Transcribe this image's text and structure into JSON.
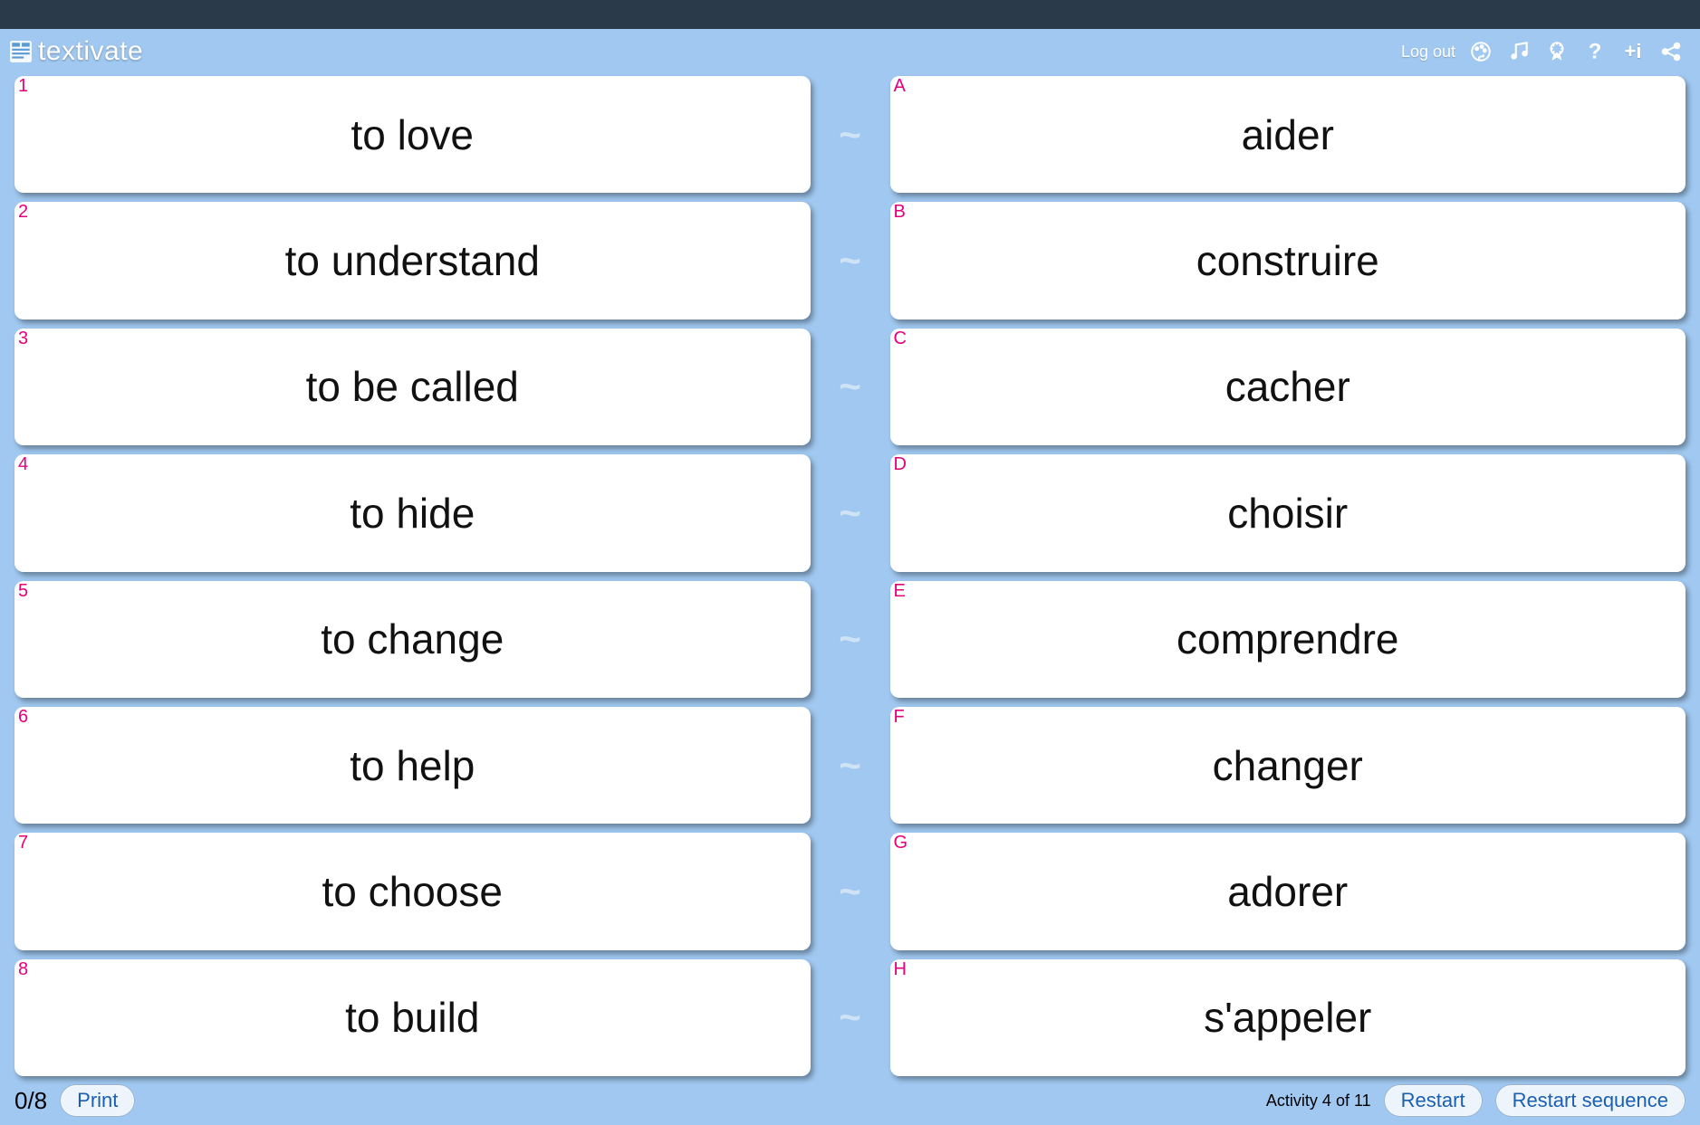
{
  "header": {
    "brand": "textivate",
    "logout": "Log out"
  },
  "left": [
    {
      "tag": "1",
      "text": "to love"
    },
    {
      "tag": "2",
      "text": "to understand"
    },
    {
      "tag": "3",
      "text": "to be called"
    },
    {
      "tag": "4",
      "text": "to hide"
    },
    {
      "tag": "5",
      "text": "to change"
    },
    {
      "tag": "6",
      "text": "to help"
    },
    {
      "tag": "7",
      "text": "to choose"
    },
    {
      "tag": "8",
      "text": "to build"
    }
  ],
  "right": [
    {
      "tag": "A",
      "text": "aider"
    },
    {
      "tag": "B",
      "text": "construire"
    },
    {
      "tag": "C",
      "text": "cacher"
    },
    {
      "tag": "D",
      "text": "choisir"
    },
    {
      "tag": "E",
      "text": "comprendre"
    },
    {
      "tag": "F",
      "text": "changer"
    },
    {
      "tag": "G",
      "text": "adorer"
    },
    {
      "tag": "H",
      "text": "s'appeler"
    }
  ],
  "tilde": "~",
  "footer": {
    "score": "0/8",
    "print": "Print",
    "activity": "Activity 4 of 11",
    "restart": "Restart",
    "restart_seq": "Restart sequence"
  }
}
